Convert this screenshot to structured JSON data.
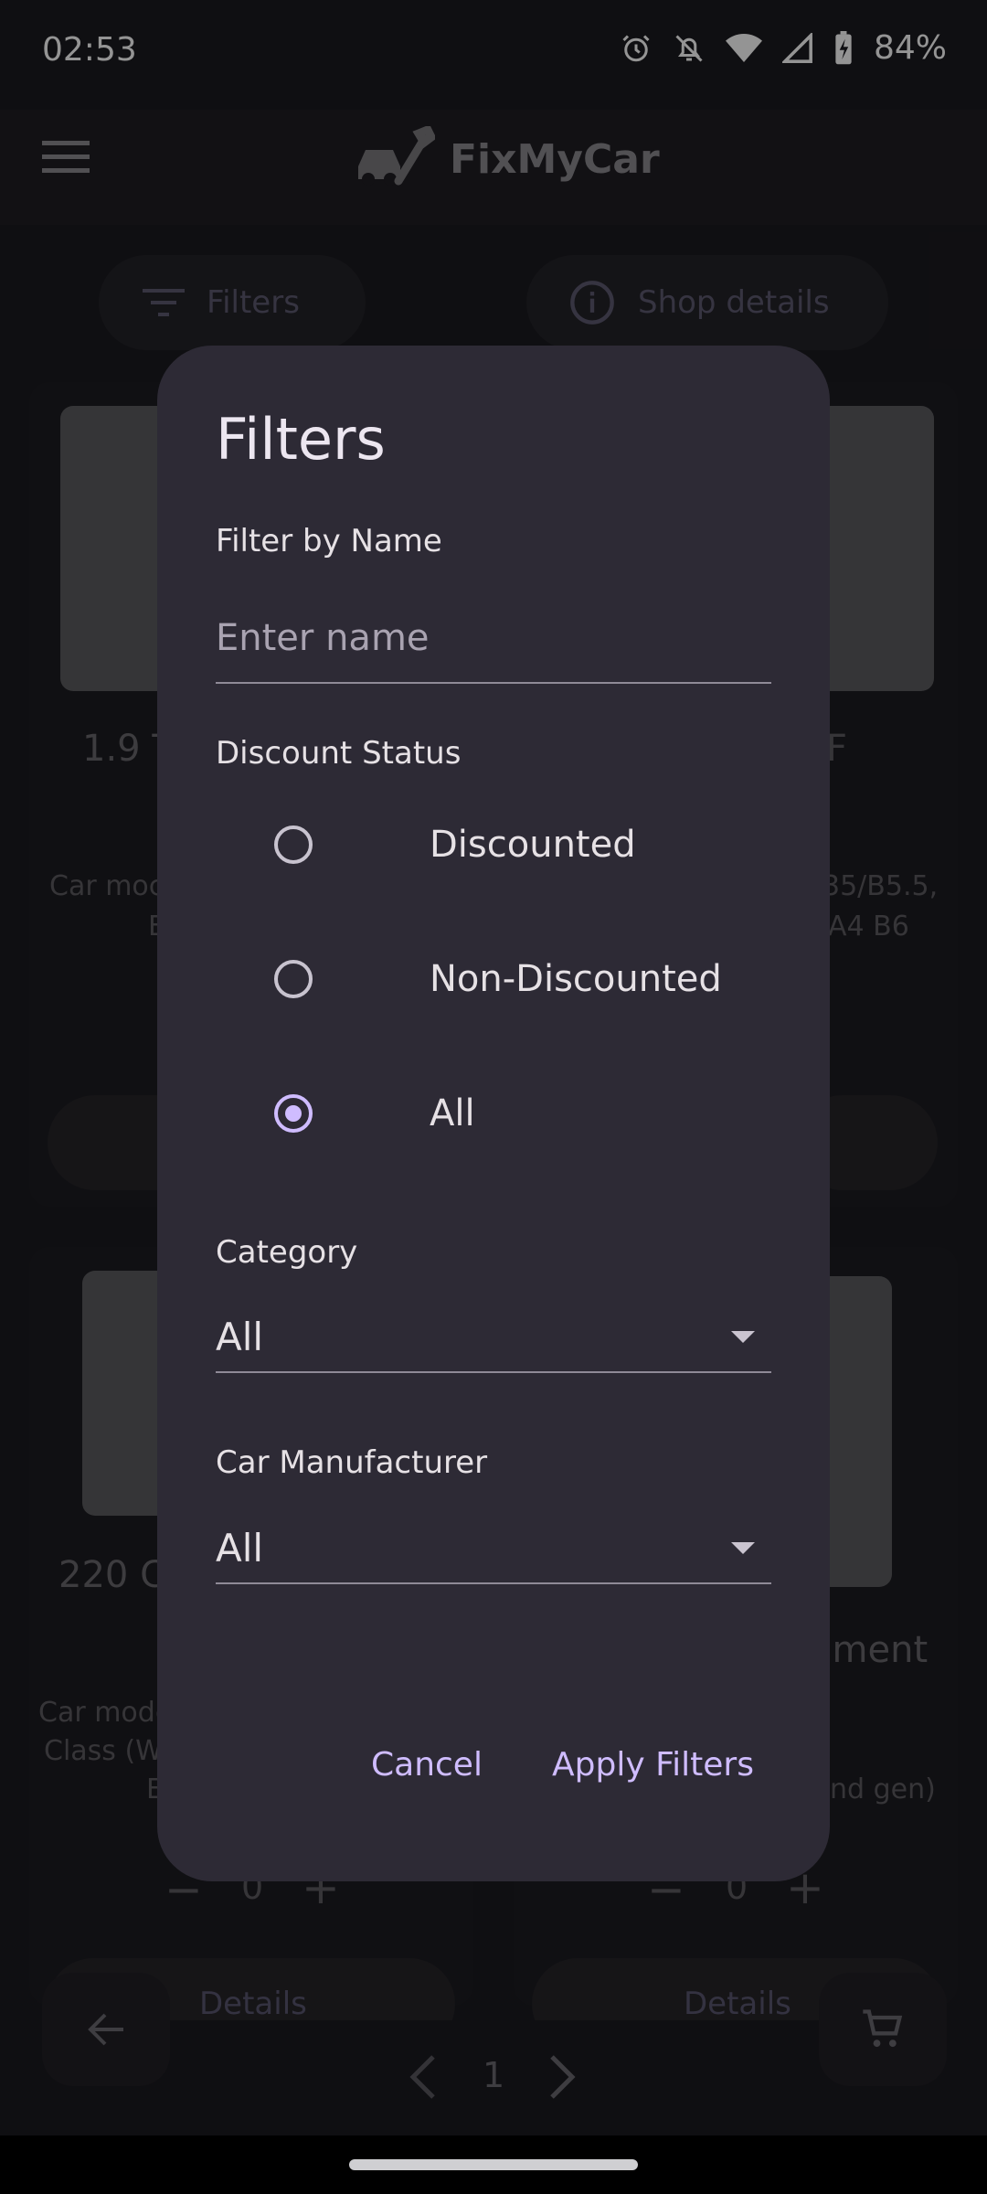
{
  "status_bar": {
    "time": "02:53",
    "battery": "84%"
  },
  "app_bar": {
    "title": "FixMyCar"
  },
  "chips": {
    "filters": "Filters",
    "shop_details": "Shop details"
  },
  "cards": {
    "card1": {
      "title_partial": "1.9 T",
      "desc_partial_1": "Car moc",
      "desc_partial_2": "E"
    },
    "card2": {
      "title_partial": "F",
      "desc_partial_1": "35/B5.5,",
      "desc_partial_2": "A4 B6"
    },
    "card3": {
      "title_partial": "220 C",
      "desc_partial_1": "Car mode",
      "desc_partial_2": "Class (W",
      "desc_partial_3": "E",
      "qty": "0",
      "details": "Details"
    },
    "card4": {
      "title_partial": "ament",
      "desc_partial_1": "nd gen)",
      "qty": "0",
      "details": "Details"
    }
  },
  "pagination": {
    "page": "1"
  },
  "dialog": {
    "title": "Filters",
    "name_label": "Filter by Name",
    "name_placeholder": "Enter name",
    "discount_label": "Discount Status",
    "radio_options": [
      "Discounted",
      "Non-Discounted",
      "All"
    ],
    "selected_option": "All",
    "category_label": "Category",
    "category_value": "All",
    "manufacturer_label": "Car Manufacturer",
    "manufacturer_value": "All",
    "cancel": "Cancel",
    "apply": "Apply Filters"
  },
  "colors": {
    "accent": "#cfbcff",
    "dialog_bg": "#2d2a35",
    "page_bg": "#1b1a1f"
  }
}
